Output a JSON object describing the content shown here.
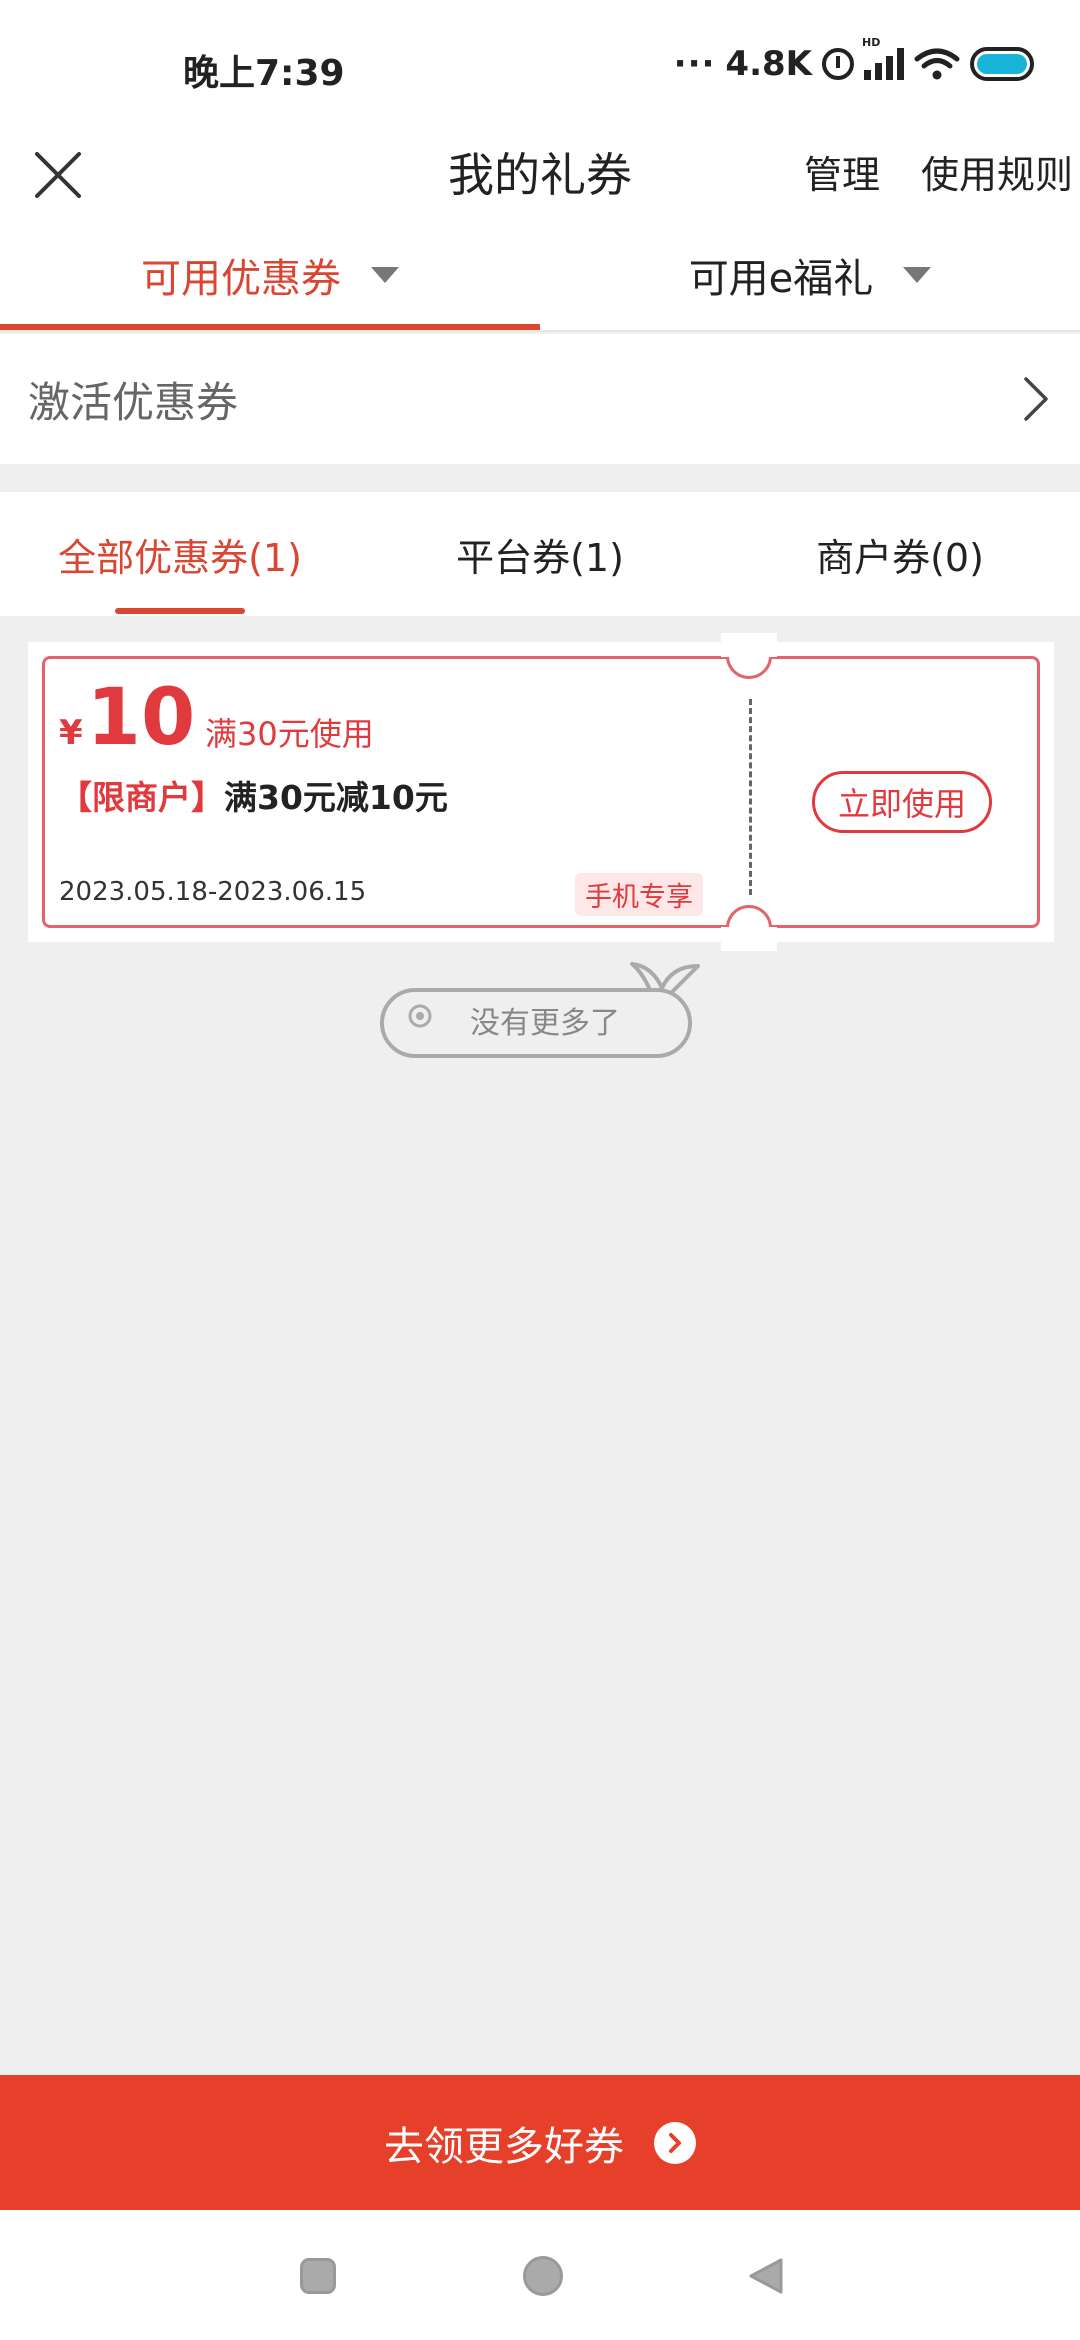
{
  "status_bar": {
    "time": "晚上7:39",
    "dots": "···",
    "net_speed": "4.8K",
    "hd_label": "HD",
    "battery_color": "#18b4d8"
  },
  "header": {
    "title": "我的礼券",
    "manage_label": "管理",
    "rules_label": "使用规则"
  },
  "top_tabs": [
    {
      "label": "可用优惠券",
      "active": true
    },
    {
      "label": "可用e福礼",
      "active": false
    }
  ],
  "activate": {
    "label": "激活优惠券"
  },
  "sub_tabs": [
    {
      "label": "全部优惠券(1)",
      "active": true
    },
    {
      "label": "平台券(1)",
      "active": false
    },
    {
      "label": "商户券(0)",
      "active": false
    }
  ],
  "coupon": {
    "currency_symbol": "¥",
    "amount": "10",
    "condition": "满30元使用",
    "tag": "【限商户】",
    "description": "满30元减10元",
    "validity": "2023.05.18-2023.06.15",
    "badge": "手机专享",
    "use_button": "立即使用"
  },
  "no_more": "没有更多了",
  "cta": {
    "label": "去领更多好券"
  },
  "colors": {
    "accent": "#d94632",
    "cta_background": "#e63f2a",
    "coupon_border": "#e5636b",
    "page_background": "#efefef"
  }
}
